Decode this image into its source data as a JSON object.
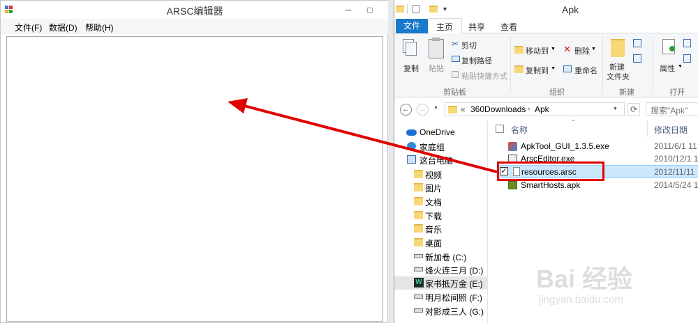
{
  "arsc": {
    "title": "ARSC编辑器",
    "menu": [
      "文件(F)",
      "数据(D)",
      "帮助(H)"
    ],
    "min_glyph": "─",
    "max_glyph": "□"
  },
  "explorer": {
    "title": "Apk",
    "tabs": [
      "文件",
      "主页",
      "共享",
      "查看"
    ],
    "ribbon": {
      "copy": "复制",
      "paste": "粘贴",
      "cut": "剪切",
      "copy_path": "复制路径",
      "paste_shortcut": "粘贴快捷方式",
      "group_clipboard": "剪贴板",
      "move_to": "移动到",
      "copy_to": "复制到",
      "delete": "删除",
      "rename": "重命名",
      "group_organize": "组织",
      "new_folder_line1": "新建",
      "new_folder_line2": "文件夹",
      "group_new": "新建",
      "properties": "属性",
      "group_open": "打开"
    },
    "address": {
      "prefix": "«",
      "segments": [
        "360Downloads",
        "Apk"
      ],
      "search_placeholder": "搜索\"Apk\""
    },
    "nav": [
      {
        "label": "OneDrive",
        "icon": "cloud-icon"
      },
      {
        "label": "家庭组",
        "icon": "homegroup-icon"
      },
      {
        "label": "这台电脑",
        "icon": "computer-icon"
      },
      {
        "label": "视频",
        "icon": "folder-icon"
      },
      {
        "label": "图片",
        "icon": "folder-icon"
      },
      {
        "label": "文档",
        "icon": "folder-icon"
      },
      {
        "label": "下载",
        "icon": "folder-icon"
      },
      {
        "label": "音乐",
        "icon": "folder-icon"
      },
      {
        "label": "桌面",
        "icon": "folder-icon"
      },
      {
        "label": "新加卷 (C:)",
        "icon": "drive-icon"
      },
      {
        "label": "烽火连三月 (D:)",
        "icon": "drive-icon"
      },
      {
        "label": "家书抵万金 (E:)",
        "icon": "drive-icon"
      },
      {
        "label": "明月松间照 (F:)",
        "icon": "drive-icon"
      },
      {
        "label": "对影成三人 (G:)",
        "icon": "drive-icon"
      }
    ],
    "columns": {
      "name": "名称",
      "modified": "修改日期"
    },
    "files": [
      {
        "name": "ApkTool_GUI_1.3.5.exe",
        "date": "2011/6/1 11",
        "icon": "exe-icon"
      },
      {
        "name": "ArscEditor.exe",
        "date": "2010/12/1 1",
        "icon": "exe-icon"
      },
      {
        "name": "resources.arsc",
        "date": "2012/11/11",
        "icon": "file-icon",
        "selected": true
      },
      {
        "name": "SmartHosts.apk",
        "date": "2014/5/24 1",
        "icon": "apk-icon"
      }
    ]
  },
  "watermark": {
    "brand": "Bai 经验",
    "url": "jingyan.baidu.com"
  },
  "colors": {
    "file_tab": "#1979ca",
    "selection": "#cce8ff",
    "arrow": "#e00000"
  }
}
